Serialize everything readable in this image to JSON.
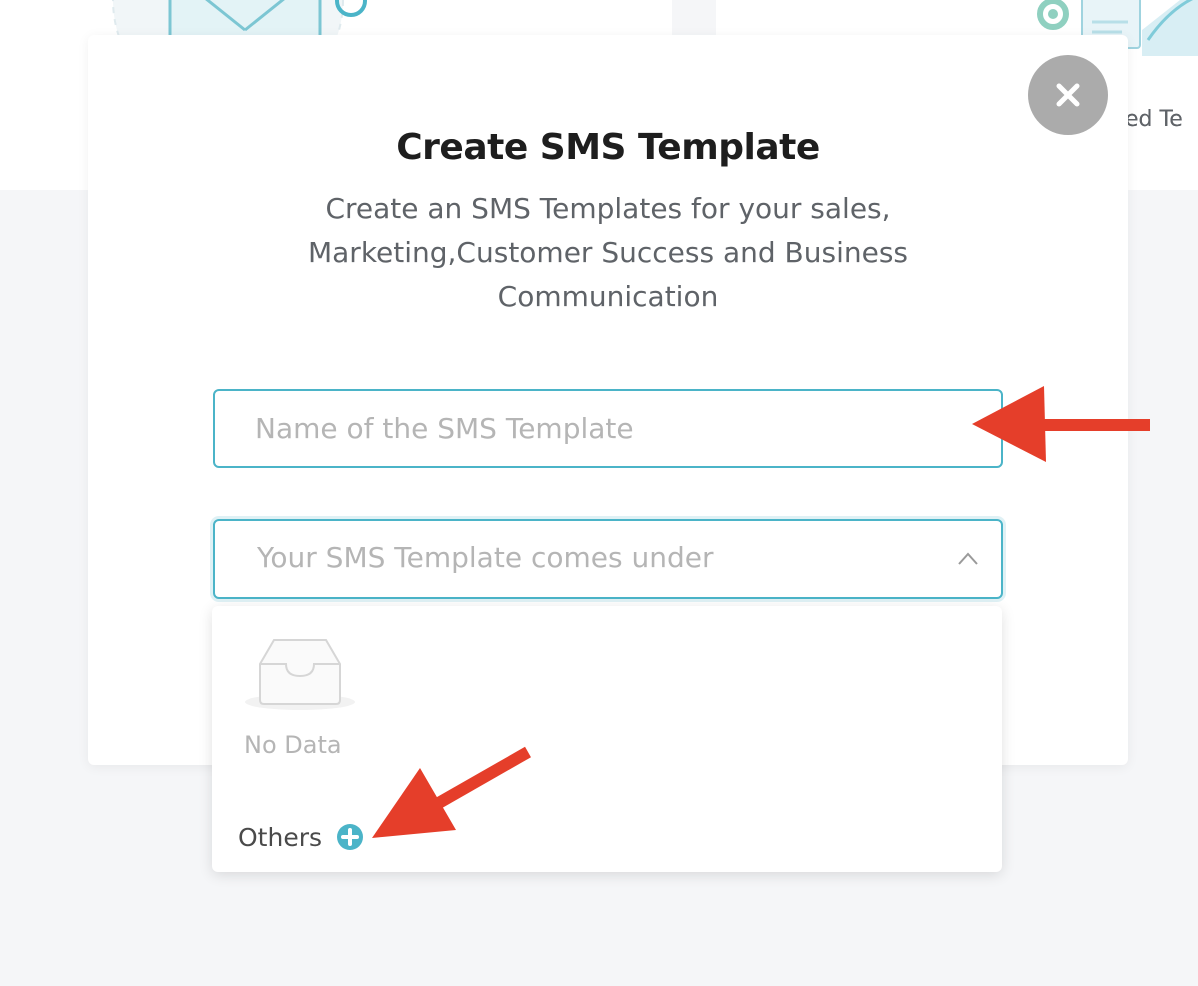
{
  "background": {
    "partial_card_text": "ved Te"
  },
  "modal": {
    "title": "Create SMS Template",
    "subtitle": "Create an SMS Templates for your sales, Marketing,Customer Success and Business Communication",
    "close_icon": "close-icon"
  },
  "form": {
    "name_placeholder": "Name of the SMS Template",
    "category_placeholder": "Your SMS Template comes under",
    "category_chevron": "chevron-up-icon"
  },
  "dropdown": {
    "empty_text": "No Data",
    "empty_icon": "empty-inbox-icon",
    "others_label": "Others",
    "others_icon": "add-circle-icon"
  },
  "colors": {
    "accent": "#4bb4c8",
    "close_button": "#ababab",
    "annotation_arrow": "#e53e2a",
    "placeholder_text": "#b5b5b5",
    "background": "#f5f6f8"
  }
}
